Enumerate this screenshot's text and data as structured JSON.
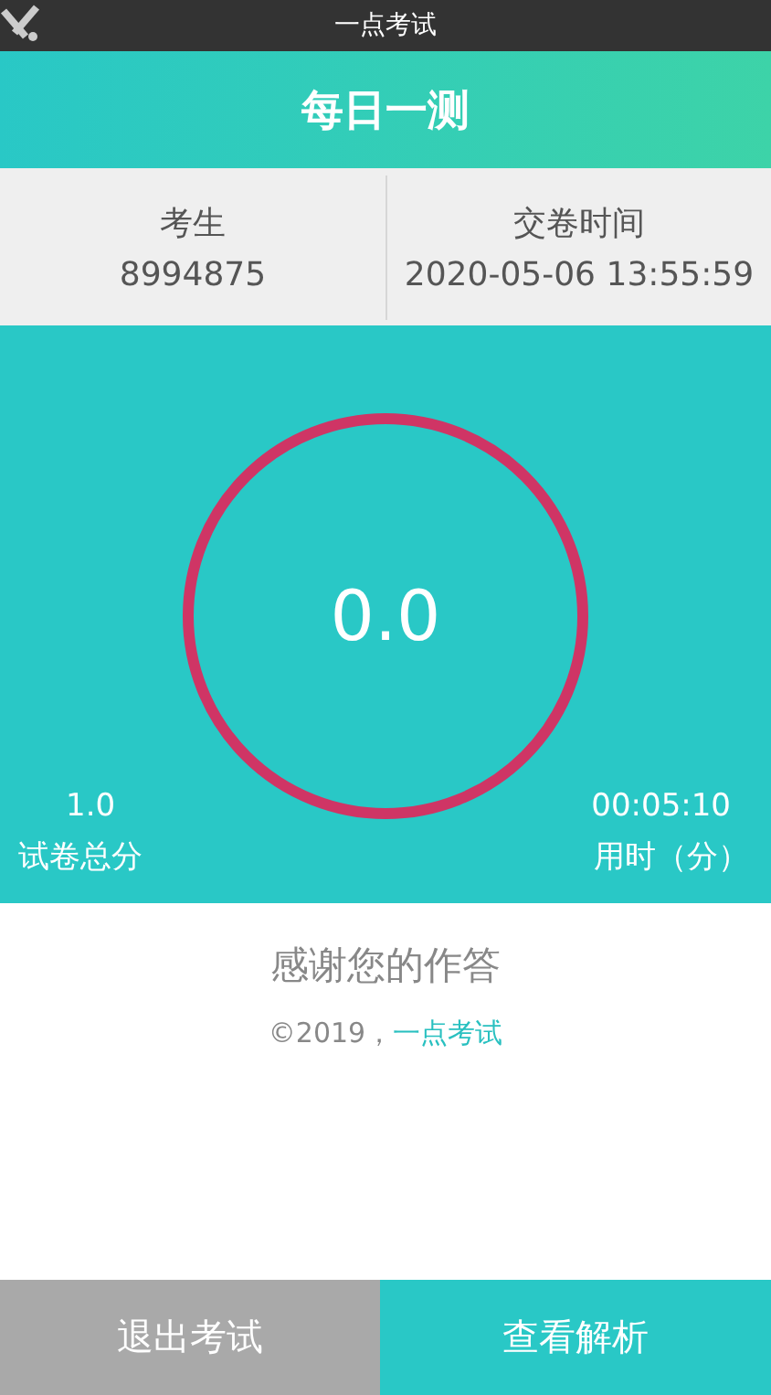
{
  "status_bar": {
    "title": "一点考试"
  },
  "header": {
    "title": "每日一测"
  },
  "info": [
    {
      "label": "考生",
      "value": "8994875"
    },
    {
      "label": "交卷时间",
      "value": "2020-05-06 13:55:59"
    }
  ],
  "score": {
    "value": "0.0"
  },
  "stats": [
    {
      "value": "1.0",
      "label": "试卷总分"
    },
    {
      "value": "00:05:10",
      "label": "用时（分）"
    }
  ],
  "message": "感谢您的作答",
  "footer": {
    "copyright": "©2019，",
    "link": "一点考试"
  },
  "buttons": [
    {
      "label": "退出考试",
      "kind": "secondary"
    },
    {
      "label": "查看解析",
      "kind": "primary"
    }
  ]
}
